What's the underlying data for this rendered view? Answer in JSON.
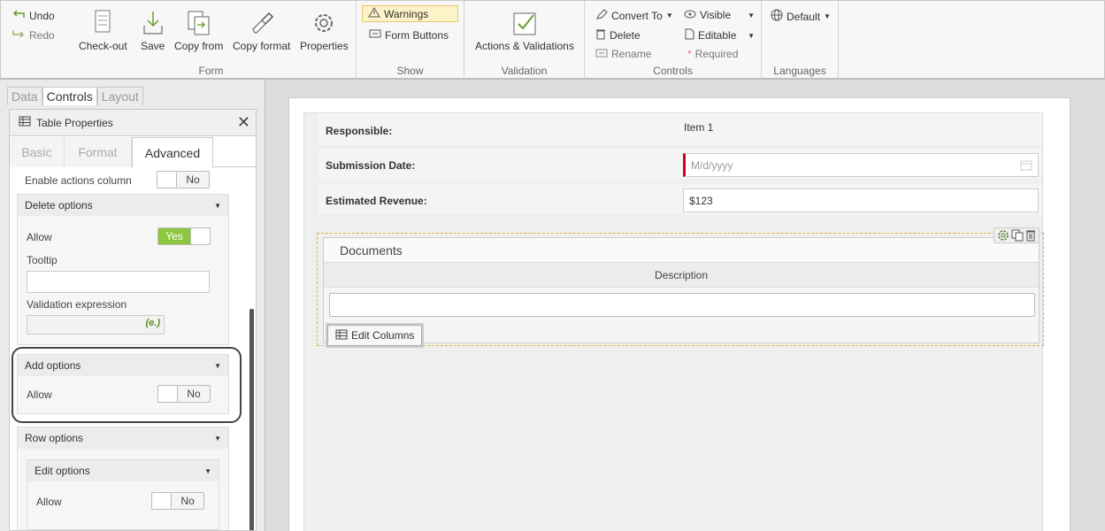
{
  "ribbon": {
    "undo": "Undo",
    "redo": "Redo",
    "form_group": {
      "label": "Form",
      "buttons": [
        "Check-out",
        "Save",
        "Copy from",
        "Copy format",
        "Properties"
      ]
    },
    "show_group": {
      "label": "Show",
      "warnings": "Warnings",
      "form_buttons": "Form Buttons"
    },
    "validation_group": {
      "label": "Validation",
      "button": "Actions & Validations"
    },
    "controls_group": {
      "label": "Controls",
      "convert_to": "Convert To",
      "delete": "Delete",
      "rename": "Rename",
      "visible": "Visible",
      "editable": "Editable",
      "required": "Required"
    },
    "languages_group": {
      "label": "Languages",
      "default": "Default"
    }
  },
  "left_panel": {
    "tabs": [
      "Data",
      "Controls",
      "Layout"
    ],
    "active_tab": "Controls",
    "props_title": "Table Properties",
    "sub_tabs": [
      "Basic",
      "Format",
      "Advanced"
    ],
    "active_sub_tab": "Advanced",
    "enable_actions_label": "Enable actions column",
    "enable_actions_value": "No",
    "delete_options": {
      "title": "Delete options",
      "allow_label": "Allow",
      "allow_value": "Yes",
      "tooltip_label": "Tooltip",
      "validation_label": "Validation expression"
    },
    "add_options": {
      "title": "Add options",
      "allow_label": "Allow",
      "allow_value": "No"
    },
    "row_options": {
      "title": "Row options",
      "edit_title": "Edit options",
      "allow_label": "Allow",
      "allow_value": "No"
    }
  },
  "form": {
    "responsible": {
      "label": "Responsible:",
      "value": "Item 1"
    },
    "submission_date": {
      "label": "Submission Date:",
      "placeholder": "M/d/yyyy"
    },
    "estimated_revenue": {
      "label": "Estimated Revenue:",
      "value": "$123"
    },
    "table": {
      "title": "Documents",
      "column": "Description",
      "edit_columns": "Edit Columns"
    }
  }
}
